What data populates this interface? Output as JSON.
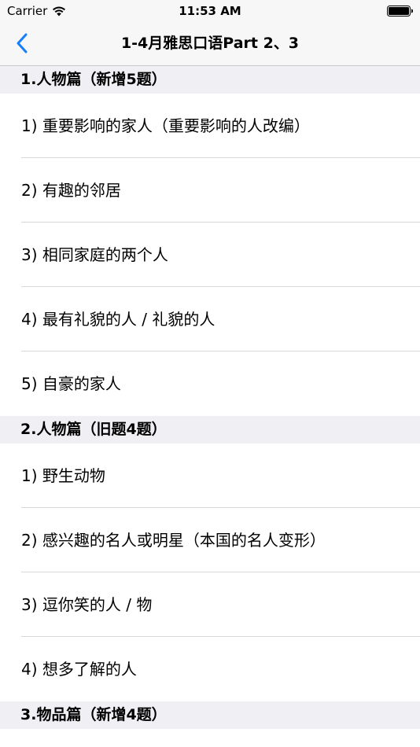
{
  "status_bar": {
    "carrier": "Carrier",
    "time": "11:53 AM"
  },
  "nav": {
    "back_icon": "chevron-left-icon",
    "title": "1-4月雅思口语Part 2、3",
    "accent_color": "#147efb"
  },
  "sections": [
    {
      "title": "1.人物篇（新增5题）",
      "items": [
        "1)  重要影响的家人（重要影响的人改编）",
        "2)  有趣的邻居",
        "3)  相同家庭的两个人",
        "4)  最有礼貌的人 / 礼貌的人",
        "5)  自豪的家人"
      ]
    },
    {
      "title": "2.人物篇（旧题4题）",
      "items": [
        "1)  野生动物",
        "2)  感兴趣的名人或明星（本国的名人变形）",
        "3)  逗你笑的人 / 物",
        "4)  想多了解的人"
      ]
    },
    {
      "title": "3.物品篇（新增4题）",
      "items": []
    }
  ]
}
